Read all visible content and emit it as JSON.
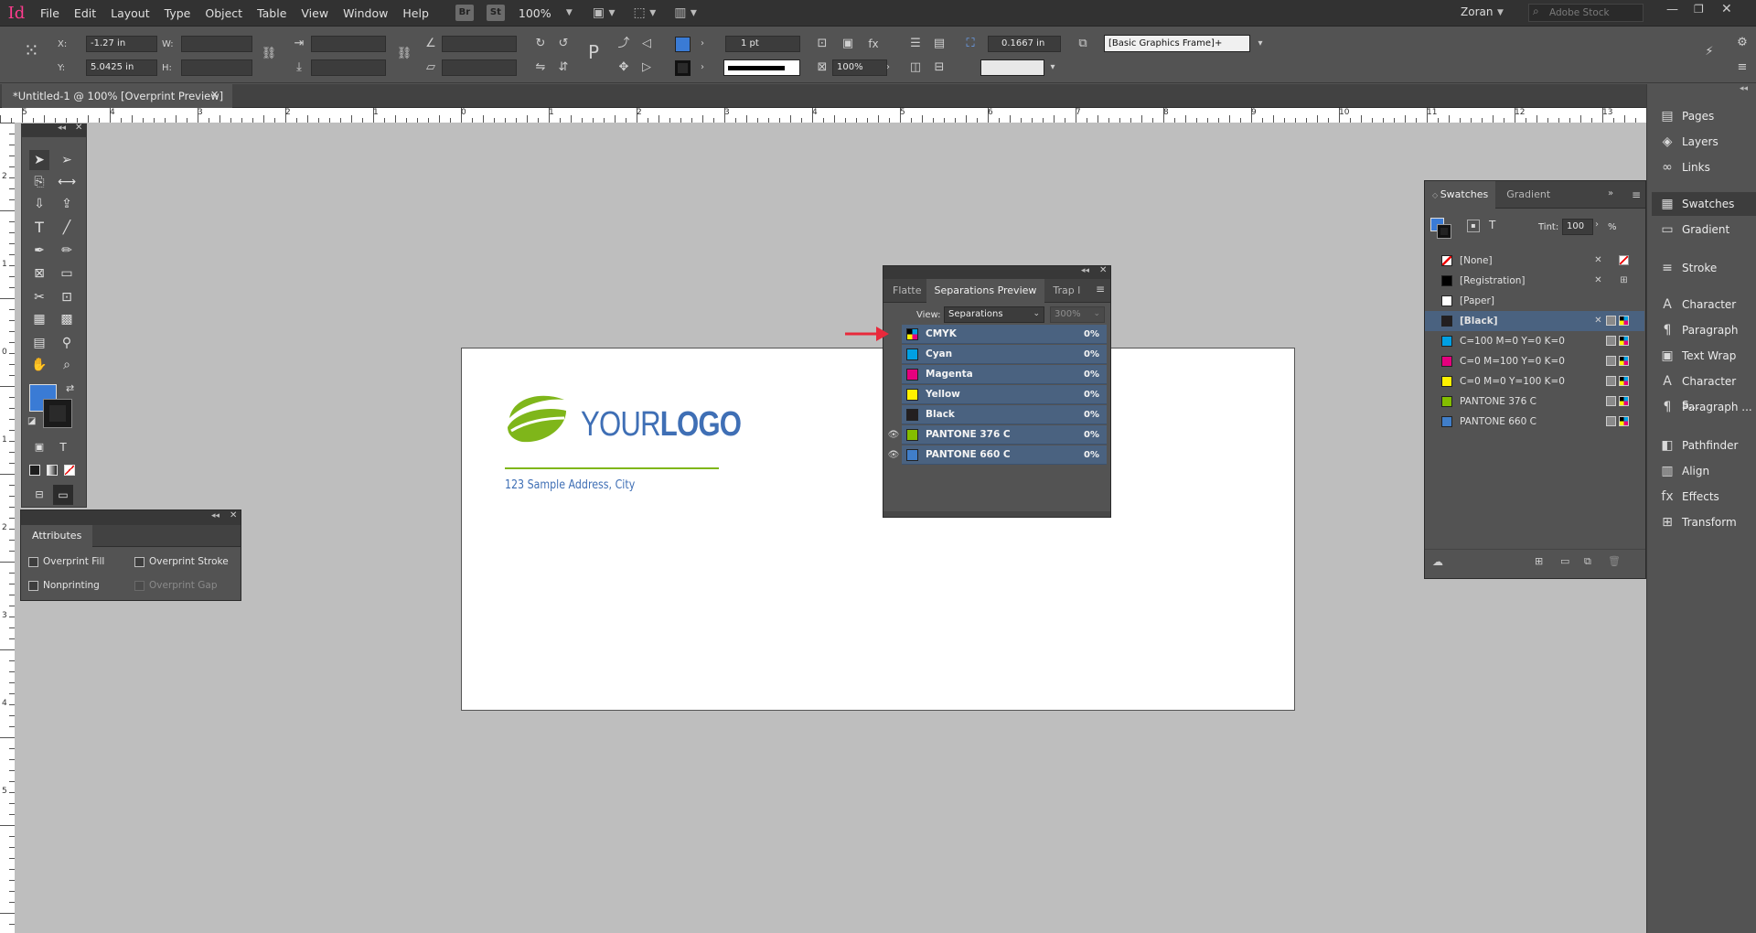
{
  "app": {
    "logo": "Id",
    "zoom": "100%",
    "bridge": "Br",
    "stock": "St",
    "user": "Zoran",
    "search_placeholder": "Adobe Stock"
  },
  "menu": [
    "File",
    "Edit",
    "Layout",
    "Type",
    "Object",
    "Table",
    "View",
    "Window",
    "Help"
  ],
  "control": {
    "x_label": "X:",
    "x_value": "-1.27 in",
    "y_label": "Y:",
    "y_value": "5.0425 in",
    "w_label": "W:",
    "h_label": "H:",
    "stroke_weight": "1 pt",
    "scale_pct": "100%",
    "corner_value": "0.1667 in",
    "object_style": "[Basic Graphics Frame]+",
    "fill_color": "#3a7bd5"
  },
  "document": {
    "tab_title": "*Untitled-1 @ 100% [Overprint Preview]"
  },
  "ruler_h": [
    "5",
    "4",
    "3",
    "2",
    "1",
    "0",
    "1",
    "2",
    "3",
    "4",
    "5",
    "6",
    "7",
    "8",
    "9",
    "10",
    "11",
    "12",
    "13"
  ],
  "ruler_v": [
    "2",
    "1",
    "0",
    "1",
    "2",
    "3",
    "4",
    "5"
  ],
  "page_content": {
    "logo_light": "YOUR",
    "logo_bold": "LOGO",
    "address": "123 Sample Address, City",
    "accent": "#7fb61a",
    "brand_blue": "#3f6fb5"
  },
  "attributes": {
    "title": "Attributes",
    "overprint_fill": "Overprint Fill",
    "overprint_stroke": "Overprint Stroke",
    "nonprinting": "Nonprinting",
    "overprint_gap": "Overprint Gap"
  },
  "separations": {
    "tabs": [
      "Flatte",
      "Separations Preview",
      "Trap l"
    ],
    "view_label": "View:",
    "view_value": "Separations",
    "zoom_value": "300%",
    "rows": [
      {
        "name": "CMYK",
        "pct": "0%",
        "color": "cmyk",
        "eye": false
      },
      {
        "name": "Cyan",
        "pct": "0%",
        "color": "#00a0e3",
        "eye": false
      },
      {
        "name": "Magenta",
        "pct": "0%",
        "color": "#e5007e",
        "eye": false
      },
      {
        "name": "Yellow",
        "pct": "0%",
        "color": "#fff200",
        "eye": false
      },
      {
        "name": "Black",
        "pct": "0%",
        "color": "#231f20",
        "eye": false
      },
      {
        "name": "PANTONE 376 C",
        "pct": "0%",
        "color": "#84bd00",
        "eye": true
      },
      {
        "name": "PANTONE 660 C",
        "pct": "0%",
        "color": "#407ec9",
        "eye": true
      }
    ]
  },
  "swatches": {
    "tabs": [
      "Swatches",
      "Gradient"
    ],
    "tint_label": "Tint:",
    "tint_value": "100",
    "tint_unit": "%",
    "items": [
      {
        "name": "[None]",
        "color": "none"
      },
      {
        "name": "[Registration]",
        "color": "#000000"
      },
      {
        "name": "[Paper]",
        "color": "#ffffff"
      },
      {
        "name": "[Black]",
        "color": "#231f20"
      },
      {
        "name": "C=100 M=0 Y=0 K=0",
        "color": "#00a0e3"
      },
      {
        "name": "C=0 M=100 Y=0 K=0",
        "color": "#e5007e"
      },
      {
        "name": "C=0 M=0 Y=100 K=0",
        "color": "#fff200"
      },
      {
        "name": "PANTONE 376 C",
        "color": "#84bd00"
      },
      {
        "name": "PANTONE 660 C",
        "color": "#407ec9"
      }
    ]
  },
  "dock": [
    {
      "label": "Pages",
      "icon": "pages-icon",
      "glyph": "▤"
    },
    {
      "label": "Layers",
      "icon": "layers-icon",
      "glyph": "◈"
    },
    {
      "label": "Links",
      "icon": "links-icon",
      "glyph": "∞"
    },
    {
      "label": "Swatches",
      "icon": "swatches-icon",
      "glyph": "▦"
    },
    {
      "label": "Gradient",
      "icon": "gradient-icon",
      "glyph": "▭"
    },
    {
      "label": "Stroke",
      "icon": "stroke-icon",
      "glyph": "≡"
    },
    {
      "label": "Character",
      "icon": "character-icon",
      "glyph": "A"
    },
    {
      "label": "Paragraph",
      "icon": "paragraph-icon",
      "glyph": "¶"
    },
    {
      "label": "Text Wrap",
      "icon": "text-wrap-icon",
      "glyph": "▣"
    },
    {
      "label": "Character S...",
      "icon": "character-styles-icon",
      "glyph": "A"
    },
    {
      "label": "Paragraph ...",
      "icon": "paragraph-styles-icon",
      "glyph": "¶"
    },
    {
      "label": "Pathfinder",
      "icon": "pathfinder-icon",
      "glyph": "◧"
    },
    {
      "label": "Align",
      "icon": "align-icon",
      "glyph": "▥"
    },
    {
      "label": "Effects",
      "icon": "effects-icon",
      "glyph": "fx"
    },
    {
      "label": "Transform",
      "icon": "transform-icon",
      "glyph": "⊞"
    }
  ]
}
